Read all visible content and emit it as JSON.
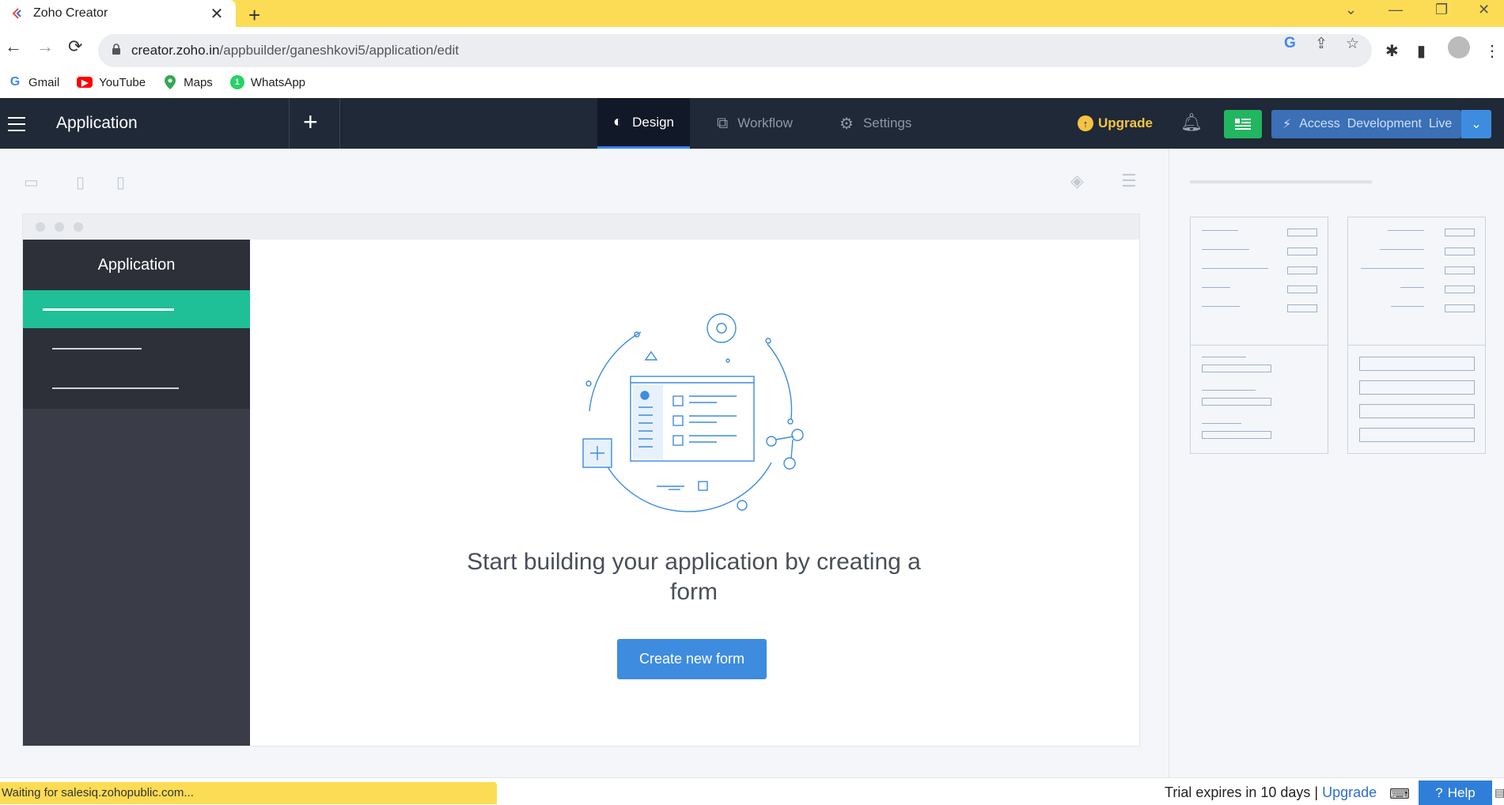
{
  "browser": {
    "tab_title": "Zoho Creator",
    "tab_close": "✕",
    "new_tab": "+",
    "url_host": "creator.zoho.in",
    "url_path": "/appbuilder/ganeshkovi5/application/edit",
    "bookmarks": [
      {
        "label": "Gmail"
      },
      {
        "label": "YouTube"
      },
      {
        "label": "Maps"
      },
      {
        "label": "WhatsApp"
      }
    ]
  },
  "header": {
    "app_title": "Application",
    "tabs": [
      {
        "label": "Design"
      },
      {
        "label": "Workflow"
      },
      {
        "label": "Settings"
      }
    ],
    "upgrade_label": "Upgrade",
    "access_label": "Access  Development  Live"
  },
  "canvas": {
    "menu_title": "Application",
    "start_text": "Start building your application by creating a form",
    "create_button": "Create new form"
  },
  "bottom": {
    "status_text": "Waiting for salesiq.zohopublic.com...",
    "trial_text": "Trial expires in 10 days |",
    "trial_upgrade": "Upgrade",
    "help_label": "Help"
  },
  "colors": {
    "accent": "#3d8ce0",
    "header_bg": "#1f2937",
    "menu_active": "#1fbf97",
    "chrome_frame": "#fddc55"
  }
}
